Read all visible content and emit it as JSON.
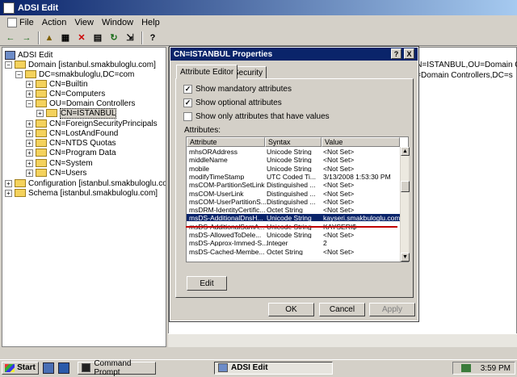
{
  "window": {
    "title": "ADSI Edit"
  },
  "menu": [
    "File",
    "Action",
    "View",
    "Window",
    "Help"
  ],
  "tree": {
    "root": "ADSI Edit",
    "domain": "Domain [istanbul.smakbuloglu.com]",
    "dc": "DC=smakbuloglu,DC=com",
    "builtin": "CN=Builtin",
    "computers": "CN=Computers",
    "ou": "OU=Domain Controllers",
    "istanbul": "CN=ISTANBUL",
    "fsp": "CN=ForeignSecurityPrincipals",
    "lostfound": "CN=LostAndFound",
    "ntds": "CN=NTDS Quotas",
    "progdata": "CN=Program Data",
    "system": "CN=System",
    "users": "CN=Users",
    "config": "Configuration [istanbul.smakbuloglu.com]",
    "schema": "Schema [istanbul.smakbuloglu.com]"
  },
  "right": {
    "line1": "CN=ISTANBUL,OU=Domain Co",
    "line2": "U=Domain Controllers,DC=s"
  },
  "dialog": {
    "title": "CN=ISTANBUL Properties",
    "help": "?",
    "close": "X",
    "tabs": [
      "Attribute Editor",
      "Security"
    ],
    "chk_mandatory": "Show mandatory attributes",
    "chk_optional": "Show optional attributes",
    "chk_values": "Show only attributes that have values",
    "attributes_label": "Attributes:",
    "columns": [
      "Attribute",
      "Syntax",
      "Value"
    ],
    "rows": [
      {
        "a": "mhsORAddress",
        "s": "Unicode String",
        "v": "<Not Set>"
      },
      {
        "a": "middleName",
        "s": "Unicode String",
        "v": "<Not Set>"
      },
      {
        "a": "mobile",
        "s": "Unicode String",
        "v": "<Not Set>"
      },
      {
        "a": "modifyTimeStamp",
        "s": "UTC Coded Ti...",
        "v": "3/13/2008 1:53:30 PM"
      },
      {
        "a": "msCOM-PartitionSetLink",
        "s": "Distinguished ...",
        "v": "<Not Set>"
      },
      {
        "a": "msCOM-UserLink",
        "s": "Distinguished ...",
        "v": "<Not Set>"
      },
      {
        "a": "msCOM-UserPartitionS...",
        "s": "Distinguished ...",
        "v": "<Not Set>"
      },
      {
        "a": "msDRM-IdentityCertific...",
        "s": "Octet String",
        "v": "<Not Set>"
      },
      {
        "a": "msDS-AdditionalDnsH...",
        "s": "Unicode String",
        "v": "kayseri.smakbuloglu.com"
      },
      {
        "a": "msDS-AdditionalSamA...",
        "s": "Unicode String",
        "v": "KAYSERI$"
      },
      {
        "a": "msDS-AllowedToDele...",
        "s": "Unicode String",
        "v": "<Not Set>"
      },
      {
        "a": "msDS-Approx-Immed-S...",
        "s": "Integer",
        "v": "2"
      },
      {
        "a": "msDS-Cached-Membe...",
        "s": "Octet String",
        "v": "<Not Set>"
      }
    ],
    "edit": "Edit",
    "ok": "OK",
    "cancel": "Cancel",
    "apply": "Apply"
  },
  "taskbar": {
    "start": "Start",
    "task1": "Command Prompt",
    "task2": "ADSI Edit",
    "clock": "3:59 PM"
  }
}
